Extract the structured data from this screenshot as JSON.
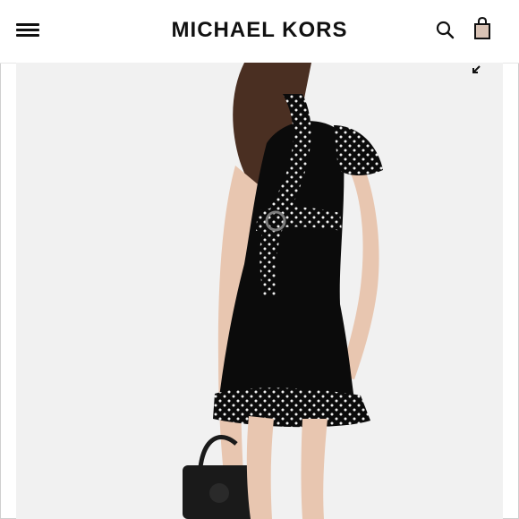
{
  "header": {
    "brand": "MICHAEL KORS"
  },
  "icons": {
    "menu": "hamburger-menu-icon",
    "search": "search-icon",
    "bag": "shopping-bag-icon",
    "expand": "expand-arrow-icon"
  },
  "colors": {
    "header_bg": "#ffffff",
    "text": "#111111",
    "bag_fill": "#d8c2b4",
    "image_bg": "#f1f1f1",
    "dress": "#0b0b0b"
  }
}
